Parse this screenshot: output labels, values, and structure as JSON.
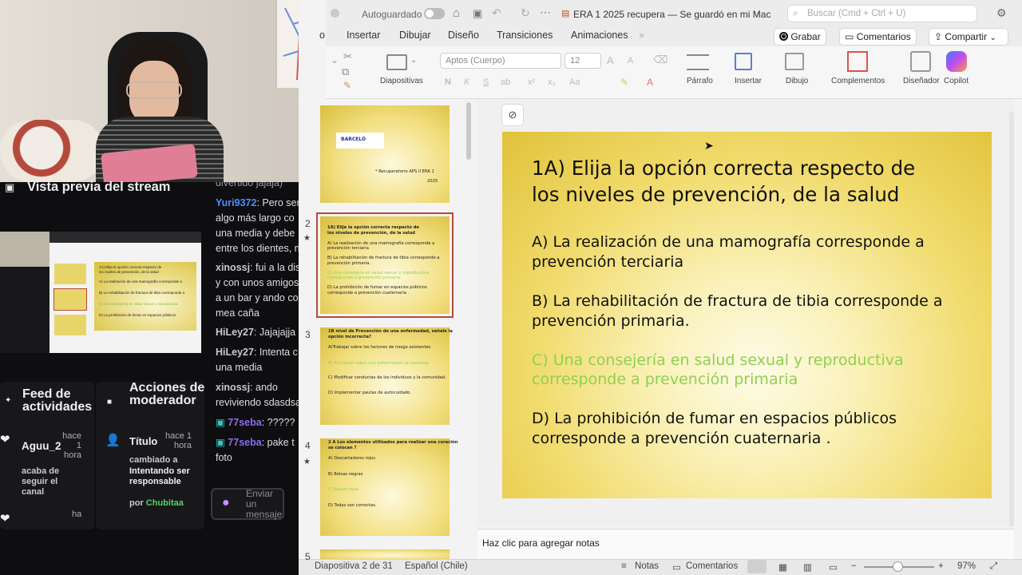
{
  "stream": {
    "preview_title": "Vista previa del stream",
    "feed_title": "Feed de actividades",
    "mod_title": "Acciones de moderador",
    "feed_item": {
      "user": "Aguu_2",
      "time": "hace 1 hora",
      "text": "acaba de seguir el canal"
    },
    "feed_time_2": "ha",
    "mod_item": {
      "label": "Título",
      "time": "hace 1 hora",
      "text_1": "cambiado a",
      "value": "Intentando ser responsable",
      "by_prefix": "por",
      "by_user": "Chubitaa"
    }
  },
  "chat": {
    "lines": [
      {
        "user": "Yuri9372",
        "text": "Pero sería",
        "color": "#4f8ef7"
      },
      {
        "text": "algo más largo co"
      },
      {
        "text": "una media y debe"
      },
      {
        "text": "entre los dientes, n"
      },
      {
        "user": "xinossj",
        "text": "fui a la dis",
        "color": "#c8c8d0"
      },
      {
        "text": "y con unos amigos"
      },
      {
        "text": "a un bar y ando co"
      },
      {
        "text": "mea caña"
      },
      {
        "user": "HiLey27",
        "text": "Jajajajja",
        "color": "#c8c8d0"
      },
      {
        "user": "HiLey27",
        "text": "Intenta c",
        "color": "#c8c8d0"
      },
      {
        "text": "una media"
      },
      {
        "user": "xinossj",
        "text": "ando",
        "color": "#c8c8d0"
      },
      {
        "text": "reviviendo sdasdsa"
      },
      {
        "user": "77seba",
        "text": "?????",
        "color": "#8a6cf0"
      },
      {
        "user": "77seba",
        "text": "pake t",
        "color": "#8a6cf0"
      },
      {
        "text": "foto"
      }
    ],
    "top_partial": "divertido jajaja)",
    "input_placeholder": "Enviar un mensaje"
  },
  "ppt": {
    "autosave_label": "Autoguardado",
    "doc_title": "ERA 1 2025 recupera — Se guardó en mi Mac",
    "search_placeholder": "Buscar (Cmd + Ctrl + U)",
    "tabs": [
      "o",
      "Insertar",
      "Dibujar",
      "Diseño",
      "Transiciones",
      "Animaciones"
    ],
    "record_label": "Grabar",
    "comments_label": "Comentarios",
    "share_label": "Compartir",
    "ribbon": {
      "slides_label": "Diapositivas",
      "font_name": "Aptos (Cuerpo)",
      "font_size": "12",
      "paragraph_label": "Párrafo",
      "insert_label": "Insertar",
      "draw_label": "Dibujo",
      "addins_label": "Complementos",
      "designer_label": "Diseñador",
      "copilot_label": "Copilot"
    },
    "thumbnails": [
      {
        "num": "",
        "logo": "BARCELÓ",
        "lines": [
          "* Recuperatorio APS II ERA 1",
          "2025"
        ]
      },
      {
        "num": "2",
        "lines": [
          "1A) Elija la opción correcta respecto de",
          "los niveles de prevención,  de la salud",
          "A) La realización de una mamografía corresponde a",
          "prevención terciaria",
          "B) La rehabilitación de fractura de tibia corresponde a",
          "prevención primaria.",
          "C) Una consejería en salud sexual y reproductiva",
          "corresponde a prevención primaria",
          "D) La prohibición de fumar en espacios públicos",
          "corresponde a prevención cuaternaria ."
        ]
      },
      {
        "num": "3",
        "lines": [
          "1B  nivel de  Prevención de una enfermedad, señale la",
          "opción incorrecta?",
          "A)Trabajar sobre los factores de riesgo existentes",
          "B) Al trabajo sobre una enfermedad ya instalada",
          "C) Modificar conductas de los individuos y la comunidad.",
          "D) Implementar pautas de autocuidado."
        ]
      },
      {
        "num": "4",
        "lines": [
          "2 A Los elementos  utilizados para realizar una curación",
          "se colocan  ?",
          "A) Descartadores rojos",
          "B) Bolsas negras",
          "C) Bolsas rojas",
          "D) Todas son correctas."
        ]
      },
      {
        "num": "5",
        "lines": [
          "2B  Al pilates la bolsa de basura"
        ]
      }
    ],
    "slide": {
      "title_1": "1A) Elija la opción correcta respecto de",
      "title_2": "los niveles de prevención,  de la salud",
      "a_1": "A) La realización de una mamografía corresponde a",
      "a_2": "prevención terciaria",
      "b_1": "B) La rehabilitación de fractura de tibia corresponde a",
      "b_2": "prevención primaria.",
      "c_1": "C) Una consejería en salud sexual y reproductiva",
      "c_2": "corresponde a prevención primaria",
      "d_1": "D) La prohibición de fumar en espacios públicos",
      "d_2": "corresponde a prevención cuaternaria .",
      "c_color": "#8fd14f"
    },
    "notes_placeholder": "Haz clic para agregar notas",
    "status": {
      "slide_counter": "Diapositiva 2 de 31",
      "language": "Español (Chile)",
      "notes_button": "Notas",
      "comments_button": "Comentarios",
      "zoom": "97%"
    }
  }
}
